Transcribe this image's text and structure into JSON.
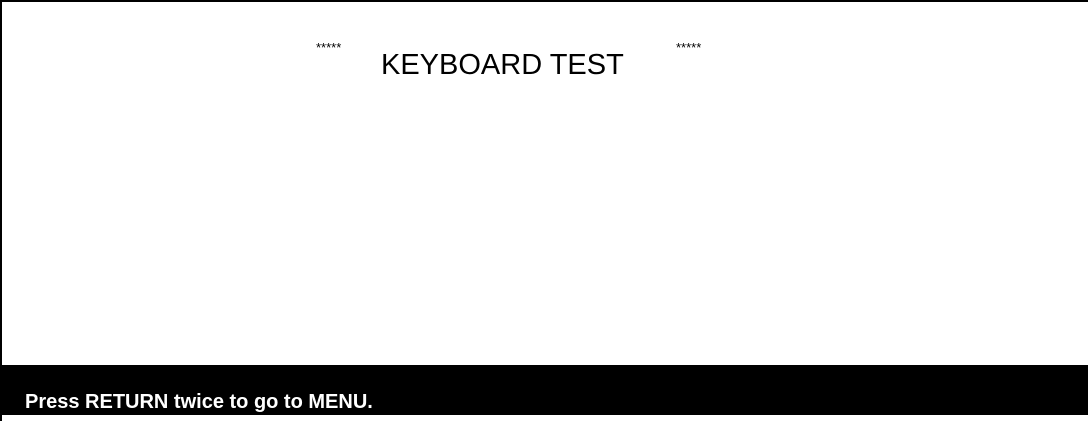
{
  "screen": {
    "title": {
      "left_stars": "*****",
      "text": "KEYBOARD TEST",
      "right_stars": "*****"
    },
    "status_bar": {
      "message": "Press RETURN twice to go to MENU."
    }
  },
  "colors": {
    "background": "#ffffff",
    "foreground": "#000000",
    "status_bar_bg": "#000000",
    "status_bar_fg": "#ffffff"
  }
}
